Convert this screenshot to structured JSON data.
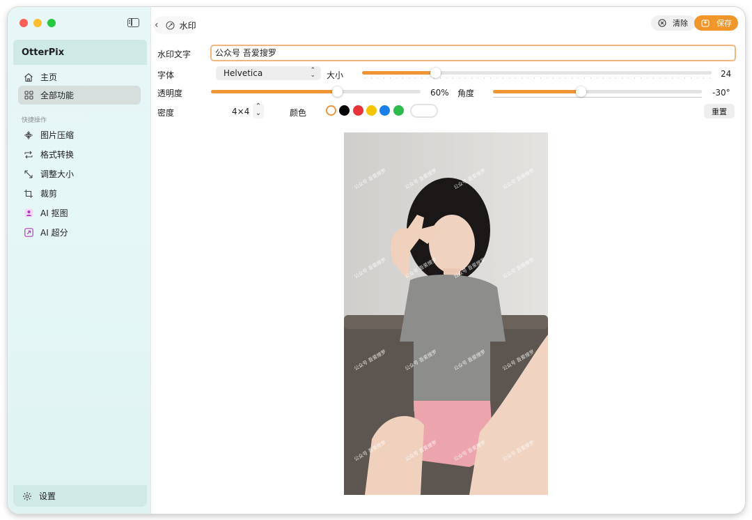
{
  "sidebar": {
    "app_name": "OtterPix",
    "items": [
      {
        "label": "主页",
        "icon": "home-icon"
      },
      {
        "label": "全部功能",
        "icon": "grid-icon"
      }
    ],
    "section_label": "快捷操作",
    "quick_items": [
      {
        "label": "图片压缩",
        "icon": "compress-icon"
      },
      {
        "label": "格式转换",
        "icon": "convert-icon"
      },
      {
        "label": "调整大小",
        "icon": "resize-icon"
      },
      {
        "label": "裁剪",
        "icon": "crop-icon"
      },
      {
        "label": "AI 抠图",
        "icon": "person-cutout-icon"
      },
      {
        "label": "AI 超分",
        "icon": "upscale-icon"
      }
    ],
    "settings_label": "设置"
  },
  "titlebar": {
    "title": "水印",
    "clear_label": "清除",
    "save_label": "保存"
  },
  "form": {
    "watermark_text_label": "水印文字",
    "watermark_text_value": "公众号 吾爱搜罗",
    "font_label": "字体",
    "font_value": "Helvetica",
    "size_label": "大小",
    "size_value": "24",
    "size_fraction": 0.21,
    "opacity_label": "透明度",
    "opacity_value": "60%",
    "opacity_fraction": 0.6,
    "angle_label": "角度",
    "angle_value": "-30°",
    "angle_fraction": 0.42,
    "density_label": "密度",
    "density_value": "4×4",
    "color_label": "颜色",
    "colors": [
      "#ffffff",
      "#000000",
      "#e8333a",
      "#f5c400",
      "#1a7fe8",
      "#2dbb4e"
    ],
    "selected_color": "#ffffff",
    "accent_color": "#ef9536",
    "reset_label": "重置"
  },
  "preview": {
    "watermark_text": "公众号 吾爱搜罗"
  }
}
